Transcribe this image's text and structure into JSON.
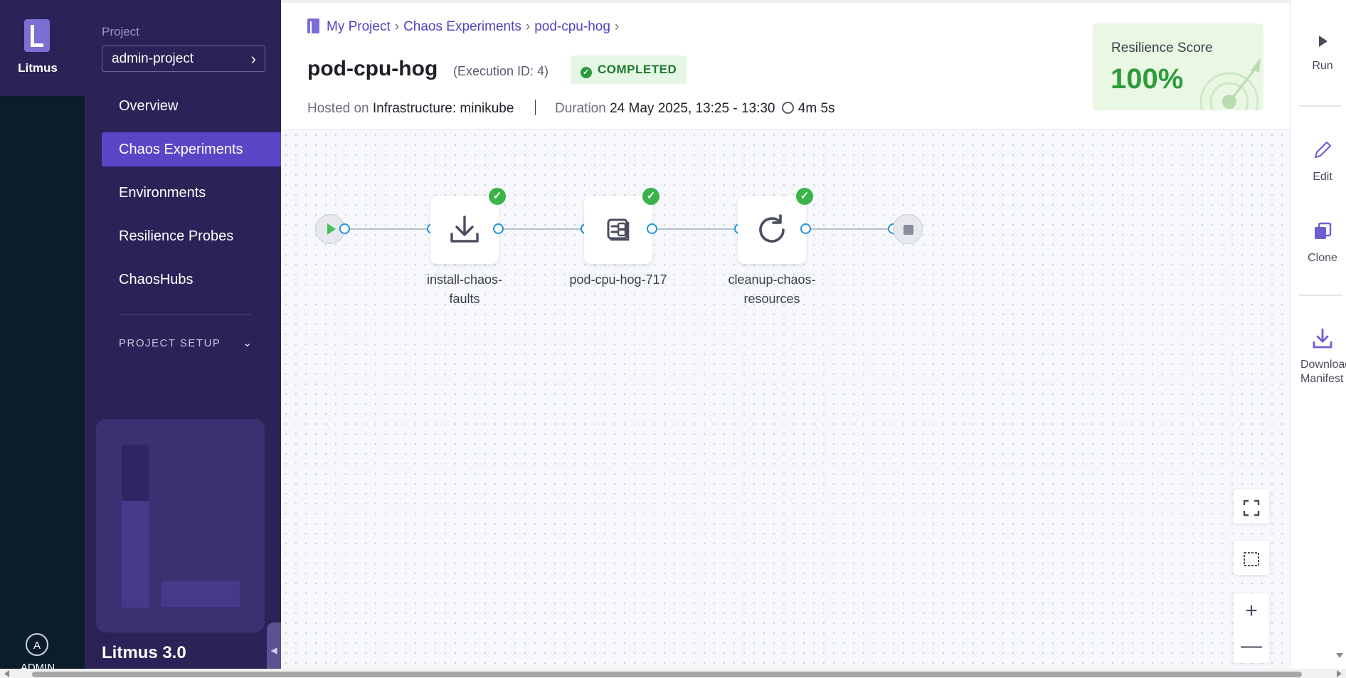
{
  "app": {
    "name": "Litmus",
    "version": "Litmus 3.0"
  },
  "user": {
    "initial": "A",
    "label": "ADMIN"
  },
  "nav": {
    "project_label": "Project",
    "project_value": "admin-project",
    "items": [
      {
        "label": "Overview"
      },
      {
        "label": "Chaos Experiments",
        "active": true
      },
      {
        "label": "Environments"
      },
      {
        "label": "Resilience Probes"
      },
      {
        "label": "ChaosHubs"
      }
    ],
    "section": "PROJECT SETUP"
  },
  "breadcrumb": [
    "My Project",
    "Chaos Experiments",
    "pod-cpu-hog"
  ],
  "header": {
    "title": "pod-cpu-hog",
    "execution_id": "(Execution ID: 4)",
    "status": "COMPLETED",
    "hosted_label": "Hosted on",
    "hosted_value": "Infrastructure: minikube",
    "duration_label": "Duration",
    "duration_value": "24 May 2025, 13:25 - 13:30",
    "elapsed": "4m 5s"
  },
  "score": {
    "label": "Resilience Score",
    "value": "100%"
  },
  "workflow": {
    "nodes": [
      {
        "label_line1": "install-chaos-",
        "label_line2": "faults",
        "icon": "download-icon",
        "status": "success"
      },
      {
        "label_line1": "pod-cpu-hog-717",
        "label_line2": "",
        "icon": "chaos-fault-icon",
        "status": "success"
      },
      {
        "label_line1": "cleanup-chaos-",
        "label_line2": "resources",
        "icon": "refresh-icon",
        "status": "success"
      }
    ]
  },
  "actions": {
    "run": "Run",
    "edit": "Edit",
    "clone": "Clone",
    "download": "Download Manifest"
  },
  "colors": {
    "accent": "#5b45c7",
    "nav_bg": "#2b2357",
    "rail_bg": "#0b1c2b",
    "success": "#3cb34a"
  }
}
